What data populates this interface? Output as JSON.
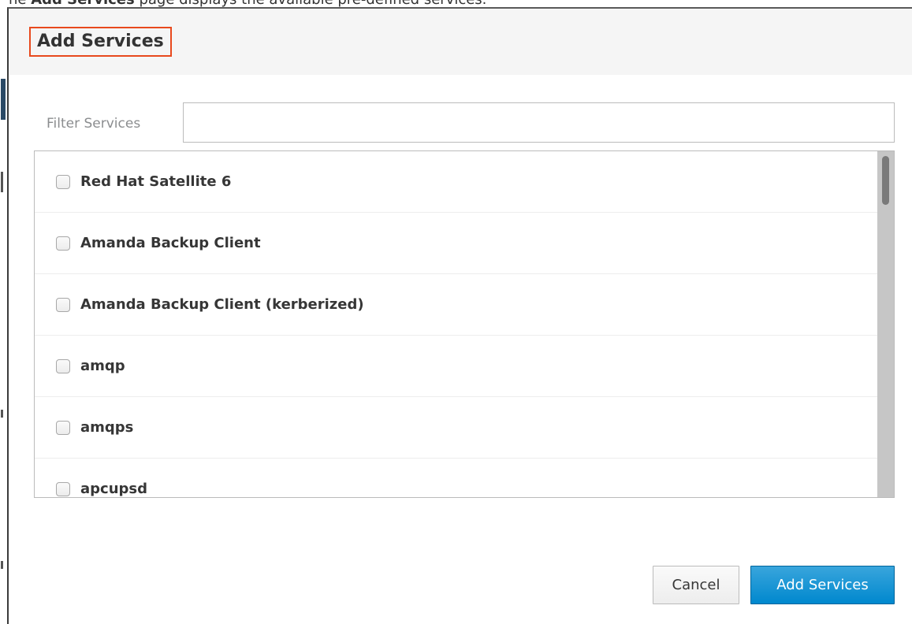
{
  "caption": {
    "prefix": "The ",
    "bold": "Add Services",
    "suffix": " page displays the available pre-defined services."
  },
  "dialog": {
    "title": "Add Services",
    "filter": {
      "label": "Filter Services",
      "value": "",
      "placeholder": ""
    },
    "services": [
      {
        "label": "Red Hat Satellite 6",
        "checked": false
      },
      {
        "label": "Amanda Backup Client",
        "checked": false
      },
      {
        "label": "Amanda Backup Client (kerberized)",
        "checked": false
      },
      {
        "label": "amqp",
        "checked": false
      },
      {
        "label": "amqps",
        "checked": false
      },
      {
        "label": "apcupsd",
        "checked": false
      }
    ],
    "buttons": {
      "cancel": "Cancel",
      "add": "Add Services"
    }
  },
  "colors": {
    "primary": "#0088ce",
    "highlight_border": "#e8491d",
    "header_bg": "#f5f5f5"
  }
}
